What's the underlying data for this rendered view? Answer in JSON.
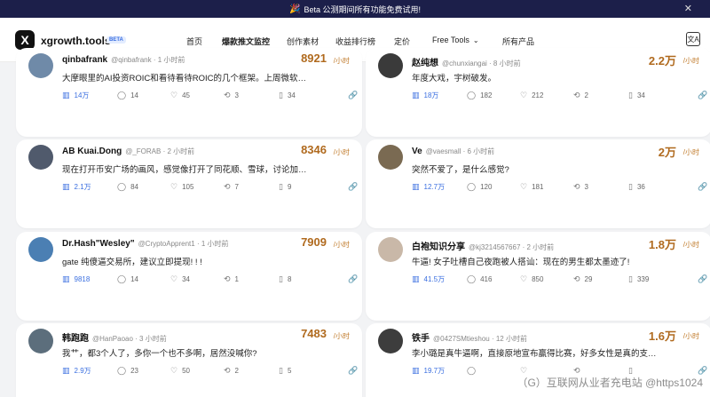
{
  "banner": {
    "text": "Beta 公测期间所有功能免费试用!",
    "close": "✕"
  },
  "header": {
    "logo": "X",
    "brand": "xgrowth.tools",
    "beta": "BETA",
    "nav": [
      "首页",
      "爆款推文监控",
      "创作素材",
      "收益排行榜",
      "定价",
      "Free Tools",
      "所有产品"
    ],
    "translate_icon": "文A"
  },
  "posts": [
    {
      "user": "qinbafrank",
      "meta": "@qinbafrank · 1 小时前",
      "count": "8921",
      "unit": "/小时",
      "text": "大摩眼里的AI投资ROIC和看待看待ROIC的几个框架。上周微软和亚马逊...",
      "views": "14万",
      "replies": "14",
      "likes": "45",
      "retweets": "3",
      "bookmarks": "34",
      "avatar_color": "#6f8aa8"
    },
    {
      "user": "赵纯想",
      "meta": "@chunxiangai · 8 小时前",
      "count": "2.2万",
      "unit": "/小时",
      "text": "年度大戏，宇树破发。",
      "views": "18万",
      "replies": "182",
      "likes": "212",
      "retweets": "2",
      "bookmarks": "34",
      "avatar_color": "#3a3a3a"
    },
    {
      "user": "AB Kuai.Dong",
      "meta": "@_FORAB · 2 小时前",
      "count": "8346",
      "unit": "/小时",
      "text": "现在打开币安广场的画风，感觉像打开了同花顺、雪球，讨论加密货币...",
      "views": "2.1万",
      "replies": "84",
      "likes": "105",
      "retweets": "7",
      "bookmarks": "9",
      "avatar_color": "#505a6c"
    },
    {
      "user": "Ve",
      "meta": "@vaesmall · 6 小时前",
      "count": "2万",
      "unit": "/小时",
      "text": "突然不爱了，是什么感觉?",
      "views": "12.7万",
      "replies": "120",
      "likes": "181",
      "retweets": "3",
      "bookmarks": "36",
      "avatar_color": "#7a6a52"
    },
    {
      "user": "Dr.Hash\"Wesley\"",
      "meta": "@CryptoApprent1 · 1 小时前",
      "count": "7909",
      "unit": "/小时",
      "text": "gate 纯傻逼交易所，建议立即提现! ! !",
      "views": "9818",
      "replies": "14",
      "likes": "34",
      "retweets": "1",
      "bookmarks": "8",
      "avatar_color": "#4b7fb3"
    },
    {
      "user": "白袍知识分享",
      "meta": "@kj3214567667 · 2 小时前",
      "count": "1.8万",
      "unit": "/小时",
      "text": "牛逼! 女子吐槽自己夜跑被人搭讪：现在的男生都太墨迹了!",
      "views": "41.5万",
      "replies": "416",
      "likes": "850",
      "retweets": "29",
      "bookmarks": "339",
      "avatar_color": "#c9b8a8"
    },
    {
      "user": "韩跑跑",
      "meta": "@HanPaoao · 3 小时前",
      "count": "7483",
      "unit": "/小时",
      "text": "我艹，都3个人了，多你一个也不多啊，居然没喊你?",
      "views": "2.9万",
      "replies": "23",
      "likes": "50",
      "retweets": "2",
      "bookmarks": "5",
      "avatar_color": "#5c6e7c"
    },
    {
      "user": "铁手",
      "meta": "@0427SMtieshou · 12 小时前",
      "count": "1.6万",
      "unit": "/小时",
      "text": "李小璐是真牛逼啊，直接原地宣布赢得比赛，好多女性是真的支持李小...",
      "views": "19.7万",
      "replies": "",
      "likes": "",
      "retweets": "",
      "bookmarks": "",
      "avatar_color": "#3d3d3d"
    }
  ],
  "icons": {
    "views": "bar-chart-icon",
    "replies": "comment-icon",
    "likes": "heart-icon",
    "retweets": "retweet-icon",
    "bookmarks": "bookmark-icon",
    "link": "link-icon"
  },
  "watermark": "（G）互联网从业者充电站 @https1024"
}
